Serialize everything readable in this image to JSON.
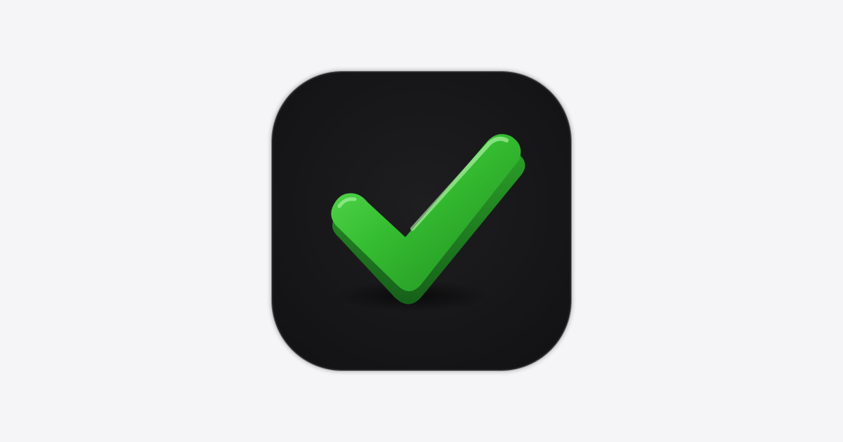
{
  "icon": {
    "name": "checkmark-icon",
    "colors": {
      "background": "#f5f5f7",
      "tile": "#161618",
      "check_light": "#4fd84a",
      "check_mid": "#2fb22c",
      "check_dark": "#1f7f1e"
    }
  }
}
